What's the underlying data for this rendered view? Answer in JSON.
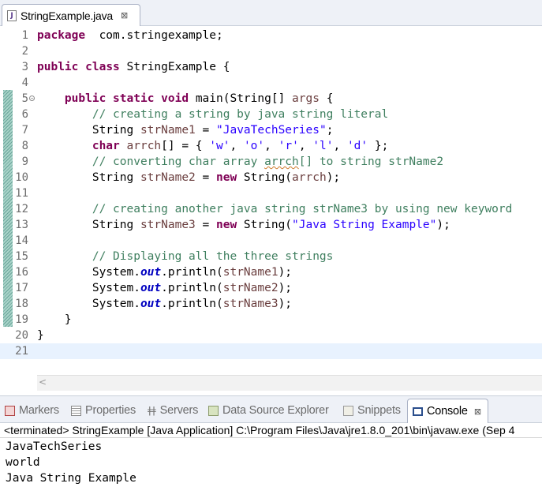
{
  "editor": {
    "tab_label": "StringExample.java",
    "file_icon_glyph": "J",
    "close_glyph": "⊠",
    "lines": [
      {
        "n": "1",
        "tokens": [
          [
            "kw",
            "package"
          ],
          [
            "",
            "  com.stringexample;"
          ]
        ]
      },
      {
        "n": "2",
        "tokens": []
      },
      {
        "n": "3",
        "tokens": [
          [
            "kw",
            "public"
          ],
          [
            "",
            " "
          ],
          [
            "kw",
            "class"
          ],
          [
            "",
            " StringExample {"
          ]
        ]
      },
      {
        "n": "4",
        "tokens": []
      },
      {
        "n": "5",
        "fold": true,
        "tokens": [
          [
            "",
            "    "
          ],
          [
            "kw",
            "public"
          ],
          [
            "",
            " "
          ],
          [
            "kw",
            "static"
          ],
          [
            "",
            " "
          ],
          [
            "kw",
            "void"
          ],
          [
            "",
            " main(String[] "
          ],
          [
            "vr",
            "args"
          ],
          [
            "",
            " {"
          ]
        ]
      },
      {
        "n": "6",
        "tokens": [
          [
            "",
            "        "
          ],
          [
            "cm",
            "// creating a string by java string literal"
          ]
        ]
      },
      {
        "n": "7",
        "tokens": [
          [
            "",
            "        String "
          ],
          [
            "vr",
            "strName1"
          ],
          [
            "",
            " = "
          ],
          [
            "st",
            "\"JavaTechSeries\""
          ],
          [
            "",
            ";"
          ]
        ]
      },
      {
        "n": "8",
        "tokens": [
          [
            "",
            "        "
          ],
          [
            "kw",
            "char"
          ],
          [
            "",
            " "
          ],
          [
            "vr",
            "arrch"
          ],
          [
            "",
            "[] = { "
          ],
          [
            "st",
            "'w'"
          ],
          [
            "",
            ", "
          ],
          [
            "st",
            "'o'"
          ],
          [
            "",
            ", "
          ],
          [
            "st",
            "'r'"
          ],
          [
            "",
            ", "
          ],
          [
            "st",
            "'l'"
          ],
          [
            "",
            ", "
          ],
          [
            "st",
            "'d'"
          ],
          [
            "",
            " };"
          ]
        ]
      },
      {
        "n": "9",
        "tokens": [
          [
            "",
            "        "
          ],
          [
            "cm",
            "// converting char array "
          ],
          [
            "cm squig",
            "arrch"
          ],
          [
            "cm",
            "[] to string strName2"
          ]
        ]
      },
      {
        "n": "10",
        "tokens": [
          [
            "",
            "        String "
          ],
          [
            "vr",
            "strName2"
          ],
          [
            "",
            " = "
          ],
          [
            "kw",
            "new"
          ],
          [
            "",
            " String("
          ],
          [
            "vr",
            "arrch"
          ],
          [
            "",
            ");"
          ]
        ]
      },
      {
        "n": "11",
        "tokens": []
      },
      {
        "n": "12",
        "tokens": [
          [
            "",
            "        "
          ],
          [
            "cm",
            "// creating another java string strName3 by using new keyword"
          ]
        ]
      },
      {
        "n": "13",
        "tokens": [
          [
            "",
            "        String "
          ],
          [
            "vr",
            "strName3"
          ],
          [
            "",
            " = "
          ],
          [
            "kw",
            "new"
          ],
          [
            "",
            " String("
          ],
          [
            "st",
            "\"Java String Example\""
          ],
          [
            "",
            ");"
          ]
        ]
      },
      {
        "n": "14",
        "tokens": []
      },
      {
        "n": "15",
        "tokens": [
          [
            "",
            "        "
          ],
          [
            "cm",
            "// Displaying all the three strings"
          ]
        ]
      },
      {
        "n": "16",
        "tokens": [
          [
            "",
            "        System."
          ],
          [
            "fd",
            "out"
          ],
          [
            "",
            ".println("
          ],
          [
            "vr",
            "strName1"
          ],
          [
            "",
            ");"
          ]
        ]
      },
      {
        "n": "17",
        "tokens": [
          [
            "",
            "        System."
          ],
          [
            "fd",
            "out"
          ],
          [
            "",
            ".println("
          ],
          [
            "vr",
            "strName2"
          ],
          [
            "",
            ");"
          ]
        ]
      },
      {
        "n": "18",
        "tokens": [
          [
            "",
            "        System."
          ],
          [
            "fd",
            "out"
          ],
          [
            "",
            ".println("
          ],
          [
            "vr",
            "strName3"
          ],
          [
            "",
            ");"
          ]
        ]
      },
      {
        "n": "19",
        "tokens": [
          [
            "",
            "    }"
          ]
        ]
      },
      {
        "n": "20",
        "tokens": [
          [
            "",
            "}"
          ]
        ]
      },
      {
        "n": "21",
        "current": true,
        "tokens": []
      }
    ]
  },
  "views": {
    "tabs": [
      {
        "id": "markers",
        "label": "Markers",
        "icon": "markers-icon"
      },
      {
        "id": "properties",
        "label": "Properties",
        "icon": "properties-icon"
      },
      {
        "id": "servers",
        "label": "Servers",
        "icon": "servers-icon"
      },
      {
        "id": "datasource",
        "label": "Data Source Explorer",
        "icon": "data-source-explorer-icon"
      },
      {
        "id": "snippets",
        "label": "Snippets",
        "icon": "snippets-icon"
      },
      {
        "id": "console",
        "label": "Console",
        "icon": "console-icon",
        "active": true
      }
    ],
    "servers_glyph": "ǂǂ",
    "console_close_glyph": "⊠"
  },
  "console": {
    "header": "<terminated> StringExample [Java Application] C:\\Program Files\\Java\\jre1.8.0_201\\bin\\javaw.exe (Sep 4",
    "output": [
      "JavaTechSeries",
      "world",
      "Java String Example"
    ]
  },
  "scrollbar": {
    "left_arrow": "<"
  },
  "colors": {
    "keyword": "#7f0055",
    "comment": "#3f7f5f",
    "string": "#2a00ff",
    "variable": "#6a3e3e",
    "field": "#0000c0",
    "current_line": "#e8f2fe"
  }
}
